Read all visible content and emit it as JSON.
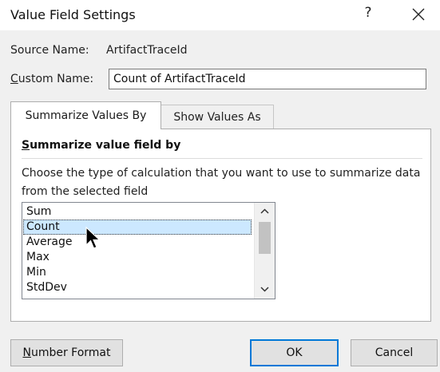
{
  "dialog": {
    "title": "Value Field Settings",
    "help_symbol": "?",
    "close_symbol": "✕"
  },
  "source": {
    "label": "Source Name:",
    "value": "ArtifactTraceId"
  },
  "custom_name": {
    "label_mnemonic": "C",
    "label_rest": "ustom Name:",
    "value": "Count of ArtifactTraceId"
  },
  "tabs": [
    {
      "label": "Summarize Values By",
      "active": true
    },
    {
      "label": "Show Values As",
      "active": false
    }
  ],
  "summarize": {
    "heading_mnemonic": "S",
    "heading_rest": "ummarize value field by",
    "description": "Choose the type of calculation that you want to use to summarize data from the selected field",
    "items": [
      "Sum",
      "Count",
      "Average",
      "Max",
      "Min",
      "StdDev"
    ],
    "selected": "Count"
  },
  "buttons": {
    "number_format_mnemonic": "N",
    "number_format_rest": "umber Format",
    "ok": "OK",
    "cancel": "Cancel"
  },
  "colors": {
    "accent": "#0078d7",
    "selection": "#cce8ff"
  }
}
